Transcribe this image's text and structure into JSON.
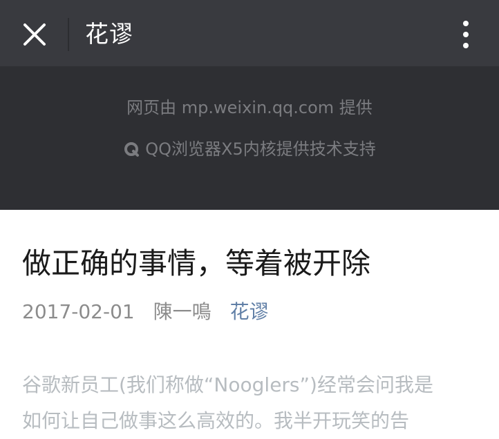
{
  "header": {
    "title": "花谬",
    "close_icon": "close-icon",
    "more_icon": "more-vertical-icon"
  },
  "provider": {
    "line1": "网页由 mp.weixin.qq.com 提供",
    "line2": "QQ浏览器X5内核提供技术支持",
    "icon": "qq-browser-icon"
  },
  "article": {
    "title": "做正确的事情，等着被开除",
    "date": "2017-02-01",
    "author": "陳一鳴",
    "account": "花谬",
    "body_line1": "谷歌新员工(我们称做“Nooglers”)经常会问我是",
    "body_line2": "如何让自己做事这么高效的。我半开玩笑的告"
  },
  "colors": {
    "topbar_bg": "#393a3f",
    "provider_bg": "#2e2f33",
    "account_link": "#607fa6"
  }
}
